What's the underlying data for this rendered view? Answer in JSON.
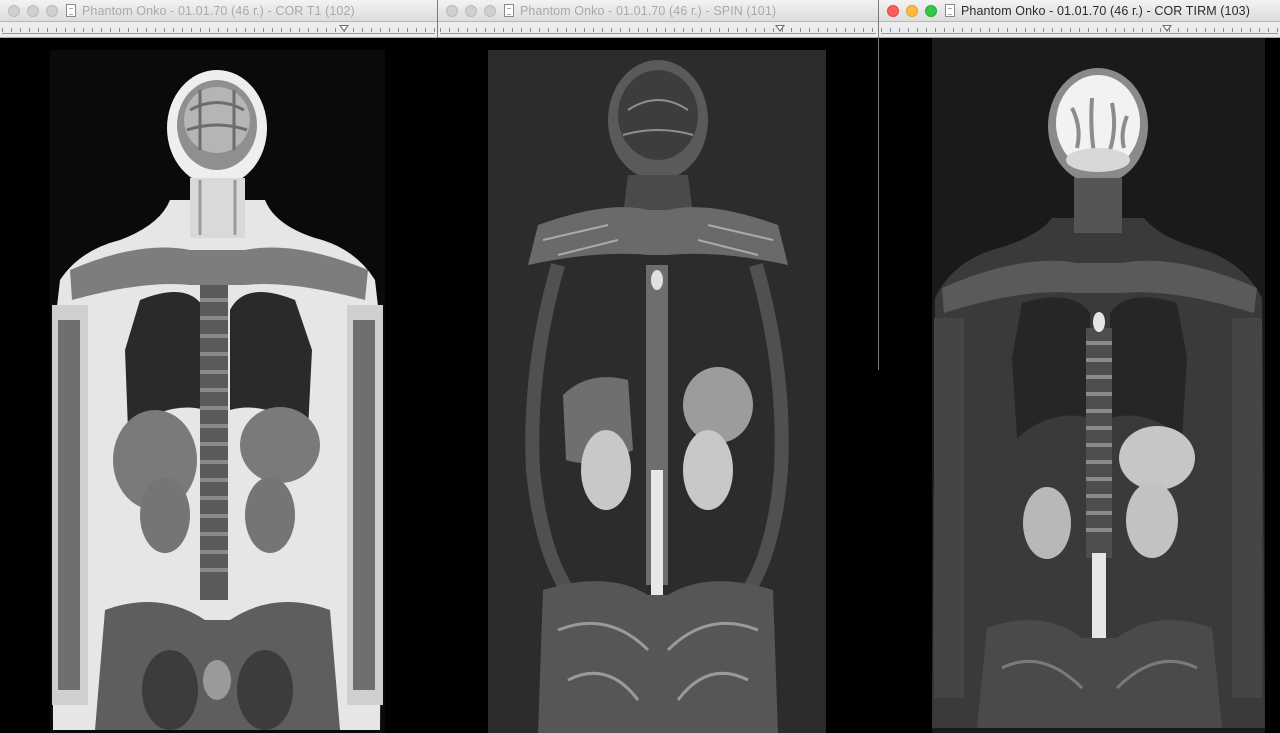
{
  "windows": [
    {
      "title": "Phantom Onko - 01.01.70 (46 г.) - COR T1 (102)",
      "active": false,
      "slider_value": 0.79
    },
    {
      "title": "Phantom Onko - 01.01.70 (46 г.) - SPIN (101)",
      "active": false,
      "slider_value": 0.78
    },
    {
      "title": "Phantom Onko - 01.01.70 (46 г.) - COR TIRM (103)",
      "active": true,
      "slider_value": 0.72
    }
  ],
  "icons": [
    "close-icon",
    "minimize-icon",
    "zoom-icon",
    "document-icon"
  ],
  "colors": {
    "close": "#fc605c",
    "minimize": "#fdbc40",
    "zoom": "#34c84a",
    "background": "#000000"
  }
}
